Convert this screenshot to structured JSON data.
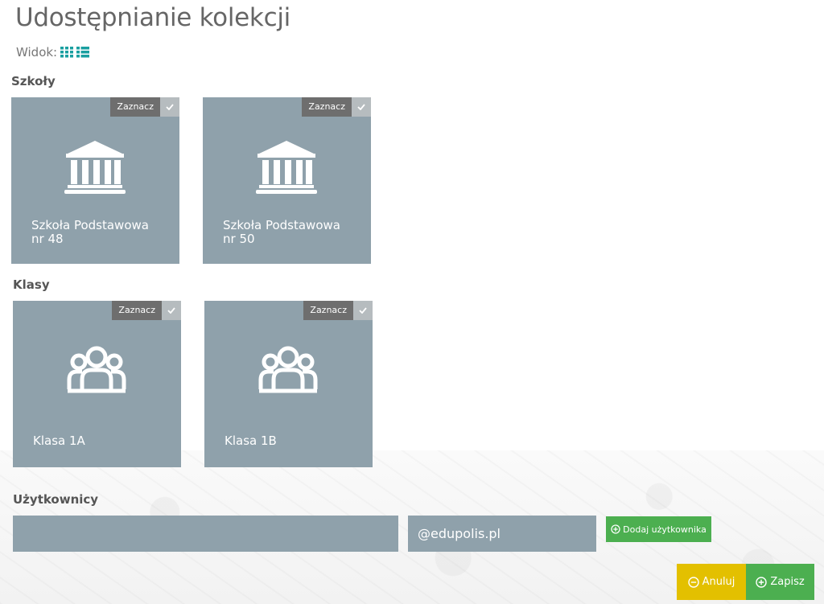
{
  "page": {
    "title": "Udostępnianie kolekcji"
  },
  "view": {
    "label": "Widok:",
    "grid_icon": "grid-icon",
    "list_icon": "list-icon",
    "accent": "#1a9fa0"
  },
  "sections": {
    "schools": "Szkoły",
    "classes": "Klasy",
    "users": "Użytkownicy"
  },
  "schools": [
    {
      "select_label": "Zaznacz",
      "line1": "Szkoła Podstawowa",
      "line2": "nr 48",
      "icon": "school-building-icon"
    },
    {
      "select_label": "Zaznacz",
      "line1": "Szkoła Podstawowa",
      "line2": "nr 50",
      "icon": "school-building-icon"
    }
  ],
  "classes": [
    {
      "select_label": "Zaznacz",
      "label": "Klasa 1A",
      "icon": "group-icon"
    },
    {
      "select_label": "Zaznacz",
      "label": "Klasa 1B",
      "icon": "group-icon"
    }
  ],
  "users": {
    "input_value": "",
    "domain": "@edupolis.pl",
    "add_button": "Dodaj użytkownika"
  },
  "actions": {
    "cancel": "Anuluj",
    "save": "Zapisz"
  },
  "colors": {
    "tile": "#8fa1ab",
    "green": "#4caf50",
    "yellow": "#e3c000"
  }
}
